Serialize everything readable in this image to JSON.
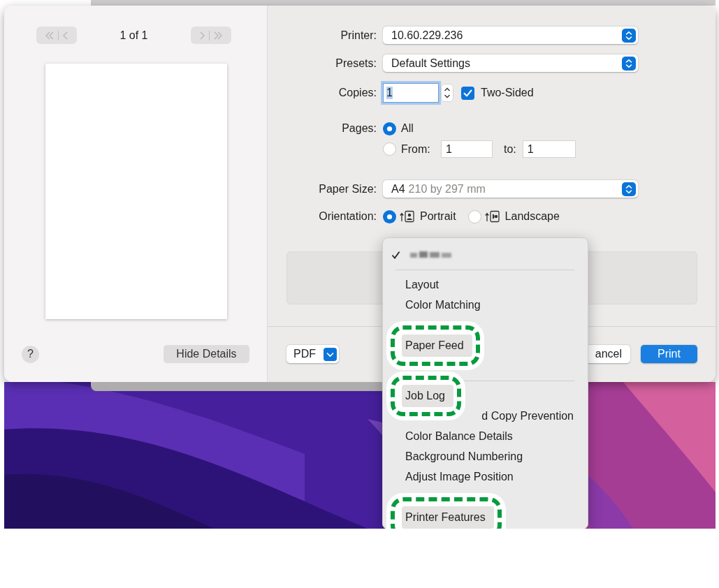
{
  "preview": {
    "page_counter": "1 of 1",
    "nav_disabled": true
  },
  "help_button": "?",
  "hide_details_button": "Hide Details",
  "form": {
    "printer": {
      "label": "Printer:",
      "value": "10.60.229.236"
    },
    "presets": {
      "label": "Presets:",
      "value": "Default Settings"
    },
    "copies": {
      "label": "Copies:",
      "value": "1",
      "focused": true
    },
    "two_sided": {
      "label": "Two-Sided",
      "checked": true
    },
    "pages": {
      "label": "Pages:",
      "options": [
        {
          "label": "All",
          "selected": true
        },
        {
          "label": "From:",
          "selected": false
        }
      ],
      "from": "1",
      "to_label": "to:",
      "to": "1"
    },
    "paper_size": {
      "label": "Paper Size:",
      "name": "A4",
      "detail": "210 by 297 mm"
    },
    "orientation": {
      "label": "Orientation:",
      "options": [
        {
          "label": "Portrait",
          "kind": "portrait",
          "selected": true
        },
        {
          "label": "Landscape",
          "kind": "landscape",
          "selected": false
        }
      ]
    }
  },
  "footer": {
    "pdf_button": "PDF",
    "cancel_button": "ancel",
    "print_button": "Print"
  },
  "menu": {
    "items": [
      {
        "kind": "blurred",
        "checked": true
      },
      {
        "kind": "separator"
      },
      {
        "kind": "item",
        "label": "Layout"
      },
      {
        "kind": "item",
        "label": "Color Matching"
      },
      {
        "kind": "covered"
      },
      {
        "kind": "callout",
        "label": "Paper Feed"
      },
      {
        "kind": "covered"
      },
      {
        "kind": "separator"
      },
      {
        "kind": "callout",
        "label": "Job Log"
      },
      {
        "kind": "clipped",
        "label": "d Copy Prevention"
      },
      {
        "kind": "item",
        "label": "Color Balance Details"
      },
      {
        "kind": "item",
        "label": "Background Numbering"
      },
      {
        "kind": "item",
        "label": "Adjust Image Position"
      },
      {
        "kind": "covered"
      },
      {
        "kind": "callout",
        "label": "Printer Features"
      }
    ]
  }
}
